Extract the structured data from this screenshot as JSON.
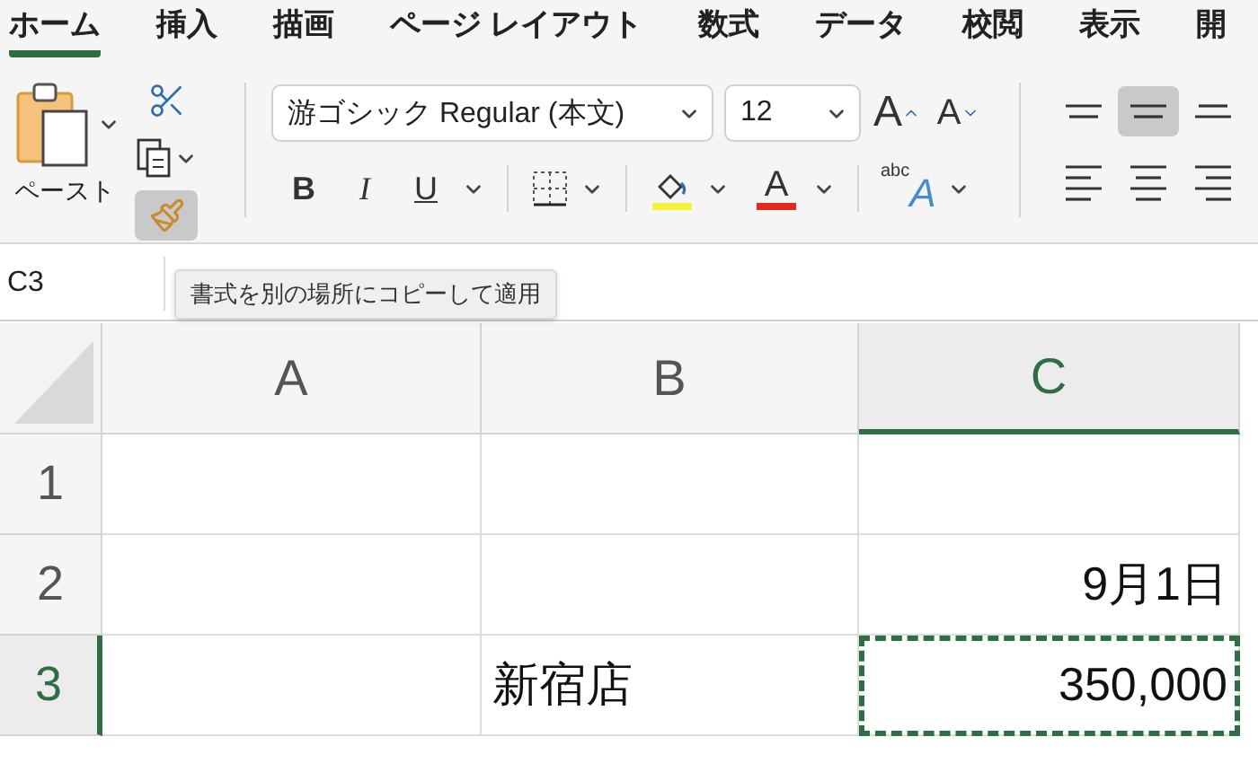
{
  "tabs": [
    {
      "label": "ホーム",
      "selected": true
    },
    {
      "label": "挿入",
      "selected": false
    },
    {
      "label": "描画",
      "selected": false
    },
    {
      "label": "ページ レイアウト",
      "selected": false
    },
    {
      "label": "数式",
      "selected": false
    },
    {
      "label": "データ",
      "selected": false
    },
    {
      "label": "校閲",
      "selected": false
    },
    {
      "label": "表示",
      "selected": false
    },
    {
      "label": "開",
      "selected": false
    }
  ],
  "clipboard": {
    "paste_label": "ペースト",
    "format_painter_selected": true
  },
  "font": {
    "name": "游ゴシック Regular (本文)",
    "size": "12",
    "grow": "A",
    "shrink": "A",
    "bold": "B",
    "italic": "I",
    "underline": "U",
    "font_color": "A",
    "text_effect_small": "abc",
    "text_effect_large": "A"
  },
  "alignment": [
    {
      "kind": "top",
      "selected": false
    },
    {
      "kind": "middle",
      "selected": true
    },
    {
      "kind": "bottom",
      "selected": false
    },
    {
      "kind": "left",
      "selected": false
    },
    {
      "kind": "center",
      "selected": false
    },
    {
      "kind": "right",
      "selected": false
    }
  ],
  "name_box": "C3",
  "tooltip": "書式を別の場所にコピーして適用",
  "sheet": {
    "columns": [
      {
        "label": "A",
        "selected": false
      },
      {
        "label": "B",
        "selected": false
      },
      {
        "label": "C",
        "selected": true
      }
    ],
    "rows": [
      {
        "number": "1",
        "selected": false,
        "cells": [
          null,
          null,
          null
        ]
      },
      {
        "number": "2",
        "selected": false,
        "cells": [
          null,
          null,
          {
            "text": "9月1日",
            "kind": "number",
            "active": false
          }
        ]
      },
      {
        "number": "3",
        "selected": true,
        "cells": [
          null,
          {
            "text": "新宿店",
            "kind": "text",
            "active": false
          },
          {
            "text": "350,000",
            "kind": "number",
            "active": true
          }
        ]
      }
    ]
  }
}
